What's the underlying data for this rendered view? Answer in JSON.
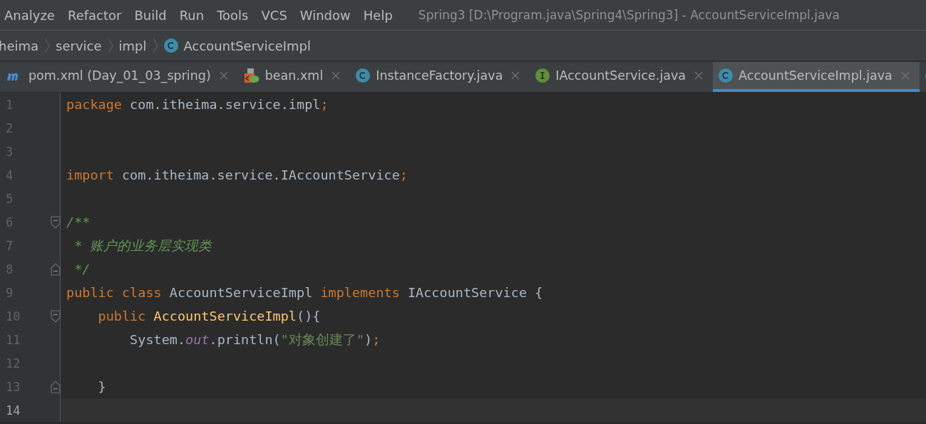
{
  "menu": [
    "Analyze",
    "Refactor",
    "Build",
    "Run",
    "Tools",
    "VCS",
    "Window",
    "Help"
  ],
  "window": {
    "title": "Spring3 [D:\\Program.java\\Spring4\\Spring3] - AccountServiceImpl.java"
  },
  "breadcrumb": [
    {
      "label": "heima",
      "kind": "folder"
    },
    {
      "label": "service",
      "kind": "folder"
    },
    {
      "label": "impl",
      "kind": "folder"
    },
    {
      "label": "AccountServiceImpl",
      "kind": "class"
    }
  ],
  "tabs": [
    {
      "label": "pom.xml (Day_01_03_spring)",
      "kind": "maven",
      "selected": false
    },
    {
      "label": "bean.xml",
      "kind": "xml",
      "selected": false
    },
    {
      "label": "InstanceFactory.java",
      "kind": "class",
      "selected": false
    },
    {
      "label": "IAccountService.java",
      "kind": "interface",
      "selected": false
    },
    {
      "label": "AccountServiceImpl.java",
      "kind": "class",
      "selected": true
    },
    {
      "kind": "runnable",
      "selected": false
    }
  ],
  "code": [
    {
      "number": "1",
      "current": false,
      "tokens": [
        {
          "text": "package",
          "kind": "keyword"
        },
        {
          "text": " com.itheima.service.impl",
          "kind": "plain"
        },
        {
          "text": ";",
          "kind": "keyword"
        }
      ]
    },
    {
      "number": "2",
      "current": false
    },
    {
      "number": "3",
      "current": false
    },
    {
      "number": "4",
      "current": false,
      "tokens": [
        {
          "text": "import",
          "kind": "keyword"
        },
        {
          "text": " com.itheima.service.IAccountService",
          "kind": "plain"
        },
        {
          "text": ";",
          "kind": "keyword"
        }
      ]
    },
    {
      "number": "5",
      "current": false
    },
    {
      "number": "6",
      "current": false,
      "fold_start": true,
      "tokens": [
        {
          "text": "/**",
          "kind": "doc"
        }
      ]
    },
    {
      "number": "7",
      "current": false,
      "tokens": [
        {
          "text": " * 账户的业务层实现类",
          "kind": "doc"
        }
      ]
    },
    {
      "number": "8",
      "current": false,
      "fold_end": true,
      "tokens": [
        {
          "text": " */",
          "kind": "doc"
        }
      ]
    },
    {
      "number": "9",
      "current": false,
      "tokens": [
        {
          "text": "public class",
          "kind": "keyword"
        },
        {
          "text": " AccountServiceImpl ",
          "kind": "plain"
        },
        {
          "text": "implements",
          "kind": "keyword"
        },
        {
          "text": " IAccountService {",
          "kind": "plain"
        }
      ]
    },
    {
      "number": "10",
      "current": false,
      "fold_start": true,
      "tokens": [
        {
          "text": "    public",
          "kind": "keyword"
        },
        {
          "text": " AccountServiceImpl",
          "kind": "method"
        },
        {
          "text": "(){",
          "kind": "plain"
        }
      ]
    },
    {
      "number": "11",
      "current": false,
      "tokens": [
        {
          "text": "        System.",
          "kind": "plain"
        },
        {
          "text": "out",
          "kind": "field"
        },
        {
          "text": ".println(",
          "kind": "plain"
        },
        {
          "text": "\"对象创建了\"",
          "kind": "string"
        },
        {
          "text": ")",
          "kind": "plain"
        },
        {
          "text": ";",
          "kind": "keyword"
        }
      ]
    },
    {
      "number": "12",
      "current": false
    },
    {
      "number": "13",
      "current": false,
      "fold_end": true,
      "tokens": [
        {
          "text": "    }",
          "kind": "plain"
        }
      ]
    },
    {
      "number": "14",
      "current": true
    }
  ]
}
